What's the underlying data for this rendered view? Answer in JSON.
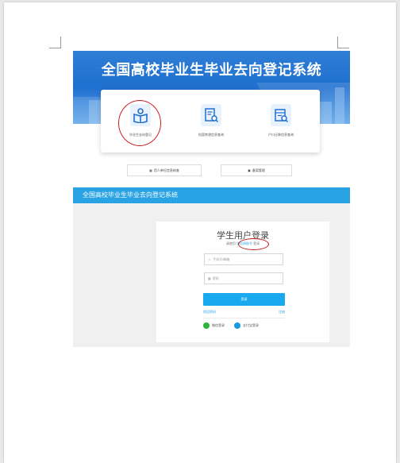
{
  "hero": {
    "title": "全国高校毕业生毕业去向登记系统"
  },
  "services": [
    {
      "label": "毕业生去向登记",
      "icon": "book-reader-icon"
    },
    {
      "label": "档案转递信息查询",
      "icon": "document-search-icon"
    },
    {
      "label": "户口迁移信息查询",
      "icon": "register-search-icon"
    }
  ],
  "mini_buttons": [
    {
      "label": "用人单位信息核查",
      "icon": "building-icon"
    },
    {
      "label": "备案管理",
      "icon": "archive-icon"
    }
  ],
  "system": {
    "title": "全国高校毕业生毕业去向登记系统"
  },
  "login": {
    "title": "学生用户登录",
    "subtitle_prefix": "请使用",
    "subtitle_link": "学信网账号",
    "subtitle_suffix": "登录",
    "username_placeholder": "手机号/邮箱",
    "password_placeholder": "密码",
    "submit_label": "登录",
    "forgot_label": "找回密码",
    "register_label": "注册",
    "wechat_label": "微信登录",
    "alipay_label": "支付宝登录"
  },
  "colors": {
    "banner_blue": "#1f6fcf",
    "bar_blue": "#29a3e3",
    "button_blue": "#19a9ef",
    "annotation_red": "#d01f1f",
    "wechat_green": "#2fb53a"
  }
}
